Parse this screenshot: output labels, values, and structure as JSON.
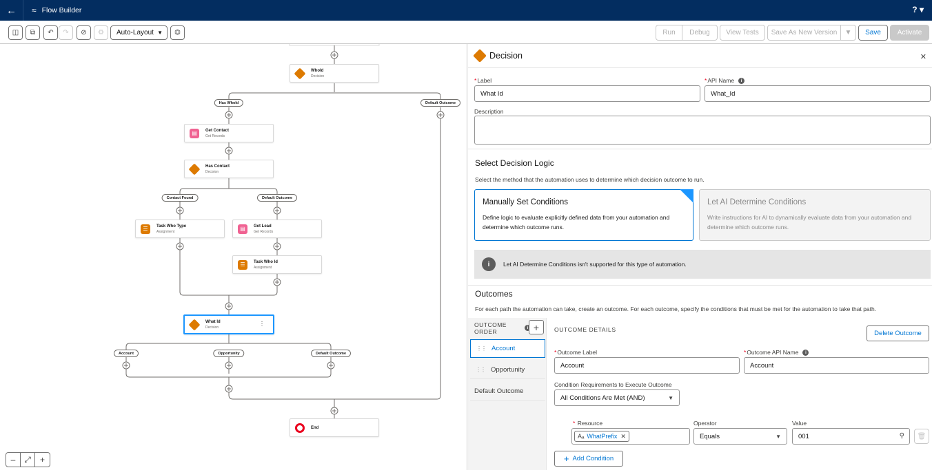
{
  "app": {
    "title": "Flow Builder",
    "help": "?",
    "back_icon": "arrow-left-icon"
  },
  "toolbar": {
    "layout_value": "Auto-Layout",
    "run": "Run",
    "debug": "Debug",
    "view_tests": "View Tests",
    "save_as_new": "Save As New Version",
    "save": "Save",
    "activate": "Activate"
  },
  "canvas": {
    "nodes": {
      "whoid": {
        "title": "WhoId",
        "sub": "Decision"
      },
      "get_contact": {
        "title": "Get Contact",
        "sub": "Get Records"
      },
      "has_contact": {
        "title": "Has Contact",
        "sub": "Decision"
      },
      "task_who_type": {
        "title": "Task Who Type",
        "sub": "Assignment"
      },
      "get_lead": {
        "title": "Get Lead",
        "sub": "Get Records"
      },
      "task_who_id": {
        "title": "Task Who Id",
        "sub": "Assignment"
      },
      "what_id": {
        "title": "What Id",
        "sub": "Decision"
      },
      "end": {
        "title": "End"
      }
    },
    "branches": {
      "has_whoid": "Has WhoId",
      "default1": "Default Outcome",
      "contact_found": "Contact Found",
      "default2": "Default Outcome",
      "account": "Account",
      "opportunity": "Opportunity",
      "default3": "Default Outcome"
    }
  },
  "panel": {
    "title": "Decision",
    "label_label": "Label",
    "label_value": "What Id",
    "api_label": "API Name",
    "api_value": "What_Id",
    "description_label": "Description",
    "logic_title": "Select Decision Logic",
    "logic_desc": "Select the method that the automation uses to determine which decision outcome to run.",
    "card_manual_title": "Manually Set Conditions",
    "card_manual_desc": "Define logic to evaluate explicitly defined data from your automation and determine which outcome runs.",
    "card_ai_title": "Let AI Determine Conditions",
    "card_ai_desc": "Write instructions for AI to dynamically evaluate data from your automation and determine which outcome runs.",
    "notice": "Let AI Determine Conditions isn't supported for this type of automation.",
    "outcomes_title": "Outcomes",
    "outcomes_desc": "For each path the automation can take, create an outcome. For each outcome, specify the conditions that must be met for the automation to take that path.",
    "outcome_order": "OUTCOME ORDER",
    "outcomes": [
      "Account",
      "Opportunity",
      "Default Outcome"
    ],
    "details_title": "OUTCOME DETAILS",
    "delete_outcome": "Delete Outcome",
    "outcome_label_label": "Outcome Label",
    "outcome_label_value": "Account",
    "outcome_api_label": "Outcome API Name",
    "outcome_api_value": "Account",
    "cond_req_label": "Condition Requirements to Execute Outcome",
    "cond_req_value": "All Conditions Are Met (AND)",
    "resource_label": "Resource",
    "resource_value": "WhatPrefix",
    "operator_label": "Operator",
    "operator_value": "Equals",
    "value_label": "Value",
    "value_value": "001",
    "add_condition": "Add Condition"
  }
}
